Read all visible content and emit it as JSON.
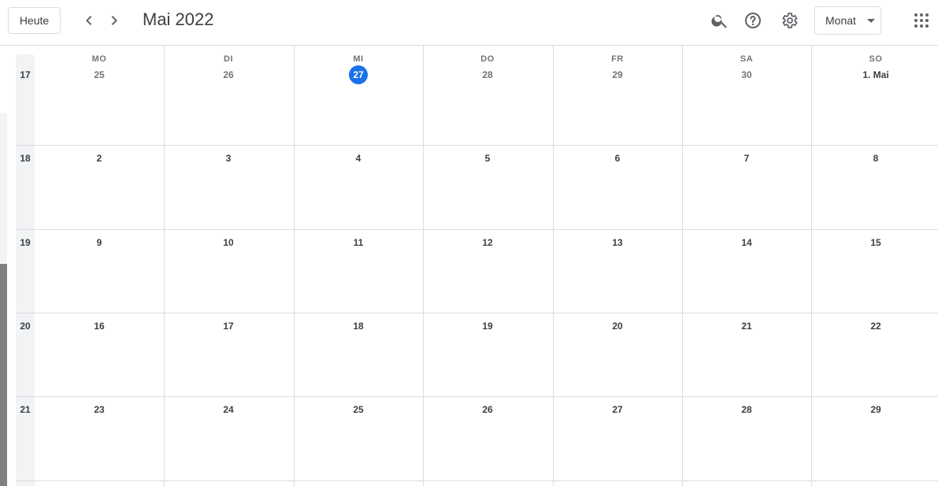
{
  "header": {
    "today_label": "Heute",
    "title": "Mai 2022",
    "view_label": "Monat",
    "icons": [
      "chevron-left-icon",
      "chevron-right-icon",
      "search-icon",
      "help-icon",
      "settings-icon",
      "apps-grid-icon"
    ]
  },
  "colors": {
    "accent": "#1a73e8",
    "border": "#dadce0",
    "weeknum_bg": "#f1f3f4"
  },
  "weekdays": [
    "MO",
    "DI",
    "MI",
    "DO",
    "FR",
    "SA",
    "SO"
  ],
  "weeks": [
    {
      "num": "17",
      "days": [
        "25",
        "26",
        "27",
        "28",
        "29",
        "30",
        "1. Mai"
      ]
    },
    {
      "num": "18",
      "days": [
        "2",
        "3",
        "4",
        "5",
        "6",
        "7",
        "8"
      ]
    },
    {
      "num": "19",
      "days": [
        "9",
        "10",
        "11",
        "12",
        "13",
        "14",
        "15"
      ]
    },
    {
      "num": "20",
      "days": [
        "16",
        "17",
        "18",
        "19",
        "20",
        "21",
        "22"
      ]
    },
    {
      "num": "21",
      "days": [
        "23",
        "24",
        "25",
        "26",
        "27",
        "28",
        "29"
      ]
    }
  ],
  "today": {
    "week": 0,
    "day": 2
  }
}
